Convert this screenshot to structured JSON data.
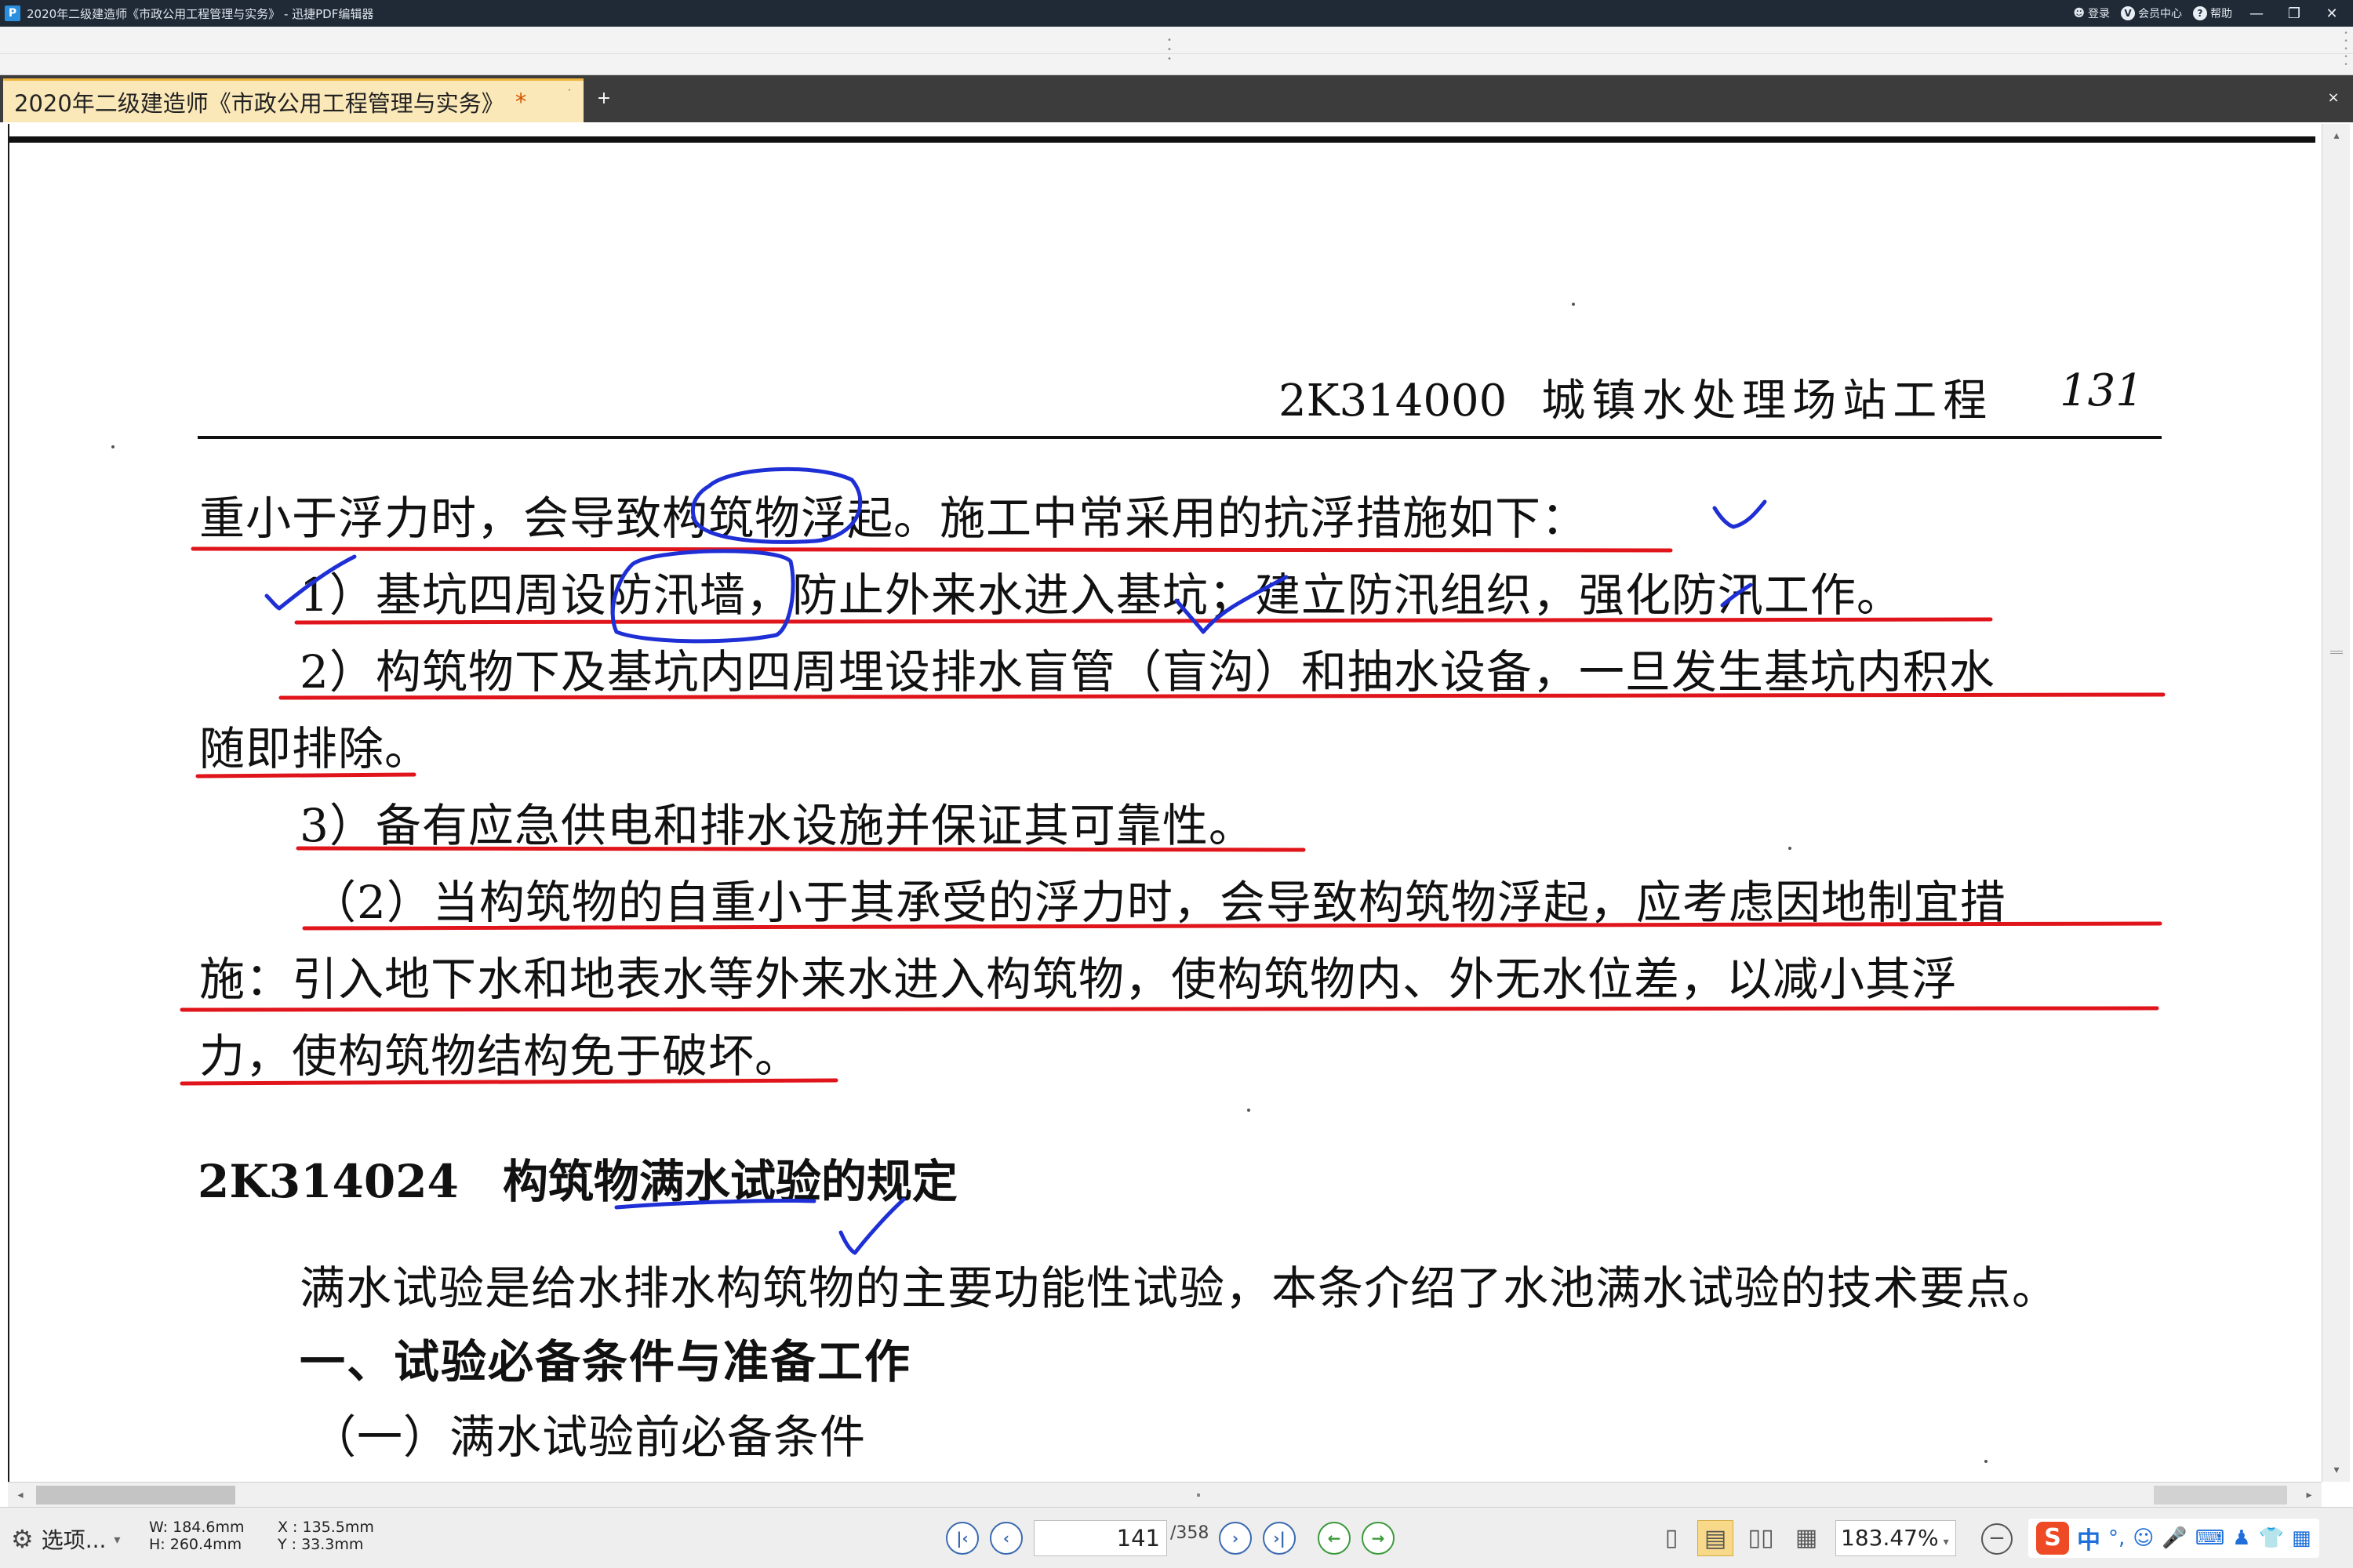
{
  "window": {
    "title": "2020年二级建造师《市政公用工程管理与实务》 - 迅捷PDF编辑器",
    "app_icon": "P",
    "login": "登录",
    "member_center": "会员中心",
    "member_badge": "V",
    "help": "帮助",
    "help_badge": "?",
    "minimize": "—",
    "restore": "❐",
    "close": "✕"
  },
  "tabs": [
    {
      "label": "2020年二级建造师《市政公用工程管理与实务》",
      "modified": "*",
      "close": "˙"
    }
  ],
  "tab_new": "+",
  "tab_close_all": "×",
  "page": {
    "running_head_code": "2K314000",
    "running_head_title": "城镇水处理场站工程",
    "page_number": "131",
    "lines": [
      "重小于浮力时，会导致构筑物浮起。施工中常采用的抗浮措施如下：",
      "1）基坑四周设防汛墙，防止外来水进入基坑；建立防汛组织，强化防汛工作。",
      "2）构筑物下及基坑内四周埋设排水盲管（盲沟）和抽水设备，一旦发生基坑内积水",
      "随即排除。",
      "3）备有应急供电和排水设施并保证其可靠性。",
      "（2）当构筑物的自重小于其承受的浮力时，会导致构筑物浮起，应考虑因地制宜措",
      "施：引入地下水和地表水等外来水进入构筑物，使构筑物内、外无水位差，以减小其浮",
      "力，使构筑物结构免于破坏。"
    ],
    "section_code": "2K314024",
    "section_title": "构筑物满水试验的规定",
    "intro": "满水试验是给水排水构筑物的主要功能性试验，本条介绍了水池满水试验的技术要点。",
    "heading_1": "一、试验必备条件与准备工作",
    "heading_2": "（一）满水试验前必备条件"
  },
  "statusbar": {
    "options_label": "选项...",
    "options_arrow": "▾",
    "width": "W: 184.6mm",
    "height": "H: 260.4mm",
    "x": "X : 135.5mm",
    "y": "Y :   33.3mm",
    "current_page": "141",
    "total_pages": "/358",
    "zoom": "183.47%",
    "zoom_arrow": "▾",
    "ime_lang": "中"
  },
  "colors": {
    "titlebar": "#1f2a36",
    "tab_active": "#fbe8b8",
    "annotation_red": "#e0151b",
    "annotation_blue": "#1f2fd6"
  },
  "icons": {
    "first_page": "first-page-icon",
    "prev_page": "prev-page-icon",
    "next_page": "next-page-icon",
    "last_page": "last-page-icon",
    "back": "back-icon",
    "forward": "forward-icon",
    "single_page": "single-page-view-icon",
    "continuous": "continuous-view-icon",
    "facing": "facing-view-icon",
    "grid": "grid-view-icon",
    "zoom_out": "zoom-out-icon"
  }
}
